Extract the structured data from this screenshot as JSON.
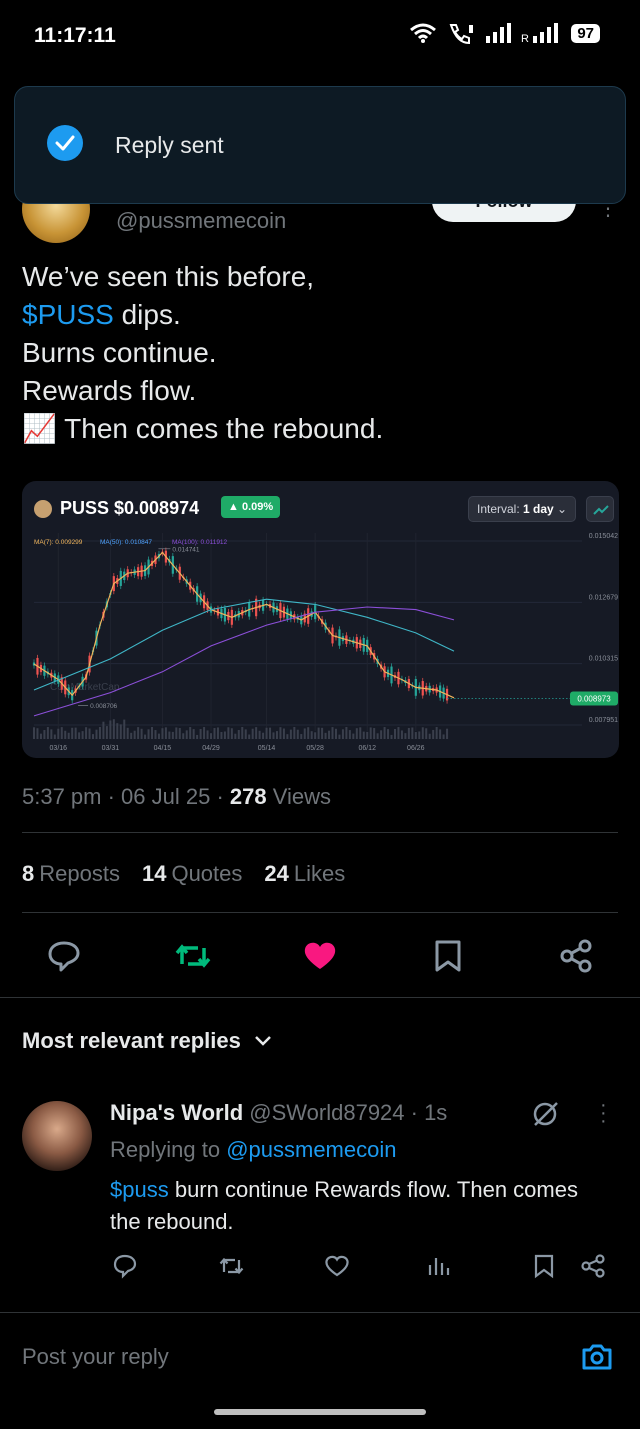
{
  "status_bar": {
    "time": "11:17:11",
    "battery": "97"
  },
  "toast": {
    "message": "Reply sent"
  },
  "tweet": {
    "handle": "@pussmemecoin",
    "follow_label": "Follow",
    "text_line1": "We’ve seen this before,",
    "cashtag": "$PUSS",
    "text_line2_rest": " dips.",
    "text_line3": " Burns continue.",
    "text_line4": " Rewards flow.",
    "text_line5": "📈 Then comes the rebound.",
    "timestamp": "5:37 pm · 06 Jul 25 · ",
    "views_count": "278",
    "views_label": " Views",
    "reposts_count": "8",
    "reposts_label": "Reposts",
    "quotes_count": "14",
    "quotes_label": "Quotes",
    "likes_count": "24",
    "likes_label": "Likes"
  },
  "chart_card": {
    "symbol_price": "PUSS $0.008974",
    "change": "0.09%",
    "interval_label": "Interval:",
    "interval_value": "1 day",
    "ma7": "MA(7): 0.009299",
    "ma50": "MA(50): 0.010847",
    "ma100": "MA(100): 0.011912",
    "high_label": "0.014741",
    "low_label": "0.008706",
    "watermark": "CoinMarketCap",
    "current_price": "0.008973"
  },
  "chart_data": {
    "type": "line",
    "title": "PUSS $0.008974",
    "x_ticks": [
      "03/16",
      "03/31",
      "04/15",
      "04/29",
      "05/14",
      "05/28",
      "06/12",
      "06/26"
    ],
    "y_ticks": [
      0.015042,
      0.012679,
      0.010315,
      0.007951
    ],
    "ylim": [
      0.007951,
      0.015042
    ],
    "series": [
      {
        "name": "MA(7): 0.009299",
        "x": [
          "03/09",
          "03/16",
          "03/20",
          "03/24",
          "03/28",
          "04/01",
          "04/05",
          "04/10",
          "04/15",
          "04/20",
          "04/25",
          "04/29",
          "05/04",
          "05/09",
          "05/14",
          "05/19",
          "05/24",
          "05/28",
          "06/02",
          "06/07",
          "06/12",
          "06/17",
          "06/22",
          "06/26",
          "07/01",
          "07/06"
        ],
        "y": [
          0.0103,
          0.0097,
          0.0091,
          0.0098,
          0.0118,
          0.0134,
          0.0138,
          0.0139,
          0.0146,
          0.0138,
          0.013,
          0.0124,
          0.0121,
          0.0124,
          0.0126,
          0.0123,
          0.012,
          0.0123,
          0.0114,
          0.0112,
          0.011,
          0.01,
          0.0097,
          0.0094,
          0.0093,
          0.009
        ]
      },
      {
        "name": "MA(50): 0.010847",
        "x": [
          "03/09",
          "03/31",
          "04/15",
          "04/29",
          "05/14",
          "05/28",
          "06/12",
          "06/26",
          "07/06"
        ],
        "y": [
          0.0093,
          0.0105,
          0.0116,
          0.0124,
          0.0128,
          0.0126,
          0.0121,
          0.0115,
          0.0108
        ]
      },
      {
        "name": "MA(100): 0.011912",
        "x": [
          "03/09",
          "03/31",
          "04/15",
          "04/29",
          "05/14",
          "05/28",
          "06/12",
          "06/26",
          "07/06"
        ],
        "y": [
          0.0083,
          0.0092,
          0.01,
          0.011,
          0.0118,
          0.0123,
          0.0125,
          0.0124,
          0.012
        ]
      }
    ],
    "annotations": [
      "0.014741",
      "0.008706"
    ],
    "current_price": 0.008973,
    "change_pct": "0.09%",
    "grid": true,
    "colors": {
      "ma7": "#f0b55c",
      "ma50": "#3fb6c7",
      "ma100": "#8b4fd8",
      "up": "#26a69a",
      "down": "#ef5350"
    }
  },
  "actions": {
    "reply": "reply-icon",
    "repost": "repost-icon",
    "like": "heart-icon",
    "bookmark": "bookmark-icon",
    "share": "share-icon"
  },
  "replies": {
    "sort_label": "Most relevant replies",
    "items": [
      {
        "name": "Nipa's World",
        "handle_time": " @SWorld87924 · 1s",
        "replying_prefix": "Replying to ",
        "replying_handle": "@pussmemecoin",
        "cashtag": "$puss",
        "text_rest": " burn continue Rewards flow. Then comes the rebound."
      }
    ]
  },
  "composer": {
    "placeholder": "Post your reply"
  },
  "colors": {
    "accent": "#1d9bf0",
    "repost_green": "#00ba7c",
    "like_pink": "#f91880"
  }
}
